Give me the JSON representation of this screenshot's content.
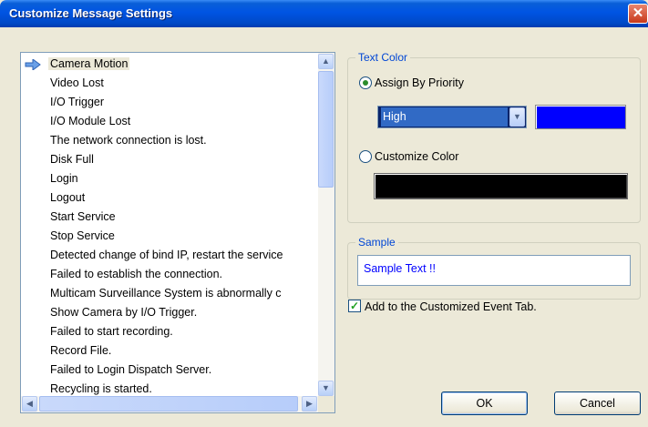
{
  "window": {
    "title": "Customize Message Settings",
    "close_glyph": "✕"
  },
  "event_list": {
    "selected_index": 0,
    "items": [
      "Camera Motion",
      "Video Lost",
      "I/O Trigger",
      "I/O Module Lost",
      "The network connection is lost.",
      "Disk Full",
      "Login",
      "Logout",
      "Start Service",
      "Stop Service",
      "Detected change of bind IP, restart the service",
      "Failed to establish the connection.",
      "Multicam Surveillance System is abnormally c",
      "Show Camera by I/O Trigger.",
      "Failed to start recording.",
      "Record File.",
      "Failed to Login Dispatch Server.",
      "Recycling is started."
    ],
    "scroll_up_glyph": "▲",
    "scroll_down_glyph": "▼",
    "scroll_left_glyph": "◀",
    "scroll_right_glyph": "▶"
  },
  "text_color": {
    "legend": "Text Color",
    "assign_by_priority_label": "Assign By Priority",
    "assign_by_priority_checked": true,
    "priority_value": "High",
    "priority_color": "#0000ff",
    "customize_color_label": "Customize Color",
    "customize_color_checked": false,
    "custom_color": "#000000",
    "dropdown_glyph": "▼"
  },
  "sample": {
    "legend": "Sample",
    "text": "Sample Text !!"
  },
  "add_to_tab": {
    "label": "Add to the Customized Event Tab.",
    "checked": true,
    "check_glyph": "✓"
  },
  "buttons": {
    "ok": "OK",
    "cancel": "Cancel"
  },
  "colors": {
    "titlebar": "#0054e3",
    "accent_legend": "#0046d5",
    "dialog_bg": "#ece9d8"
  }
}
